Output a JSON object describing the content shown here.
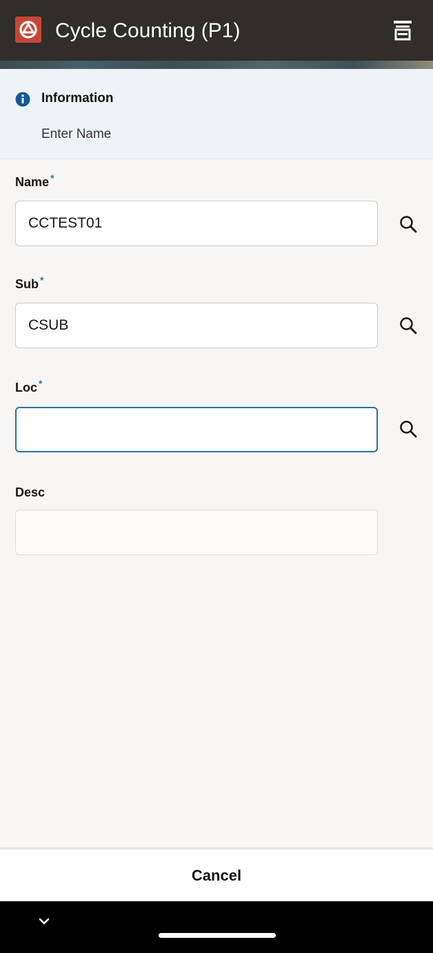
{
  "header": {
    "title": "Cycle Counting (P1)",
    "logo_icon": "oracle-logo-icon",
    "menu_icon": "page-menu-icon",
    "background_color": "#312d2a",
    "logo_color": "#c74634"
  },
  "info": {
    "icon": "info-icon",
    "title": "Information",
    "message": "Enter Name",
    "background_color": "#eef3f7"
  },
  "form": {
    "name": {
      "label": "Name",
      "required_marker": "*",
      "value": "CCTEST01",
      "search_icon": "search-icon"
    },
    "sub": {
      "label": "Sub",
      "required_marker": "*",
      "value": "CSUB",
      "search_icon": "search-icon"
    },
    "loc": {
      "label": "Loc",
      "required_marker": "*",
      "value": "",
      "search_icon": "search-icon"
    },
    "desc": {
      "label": "Desc",
      "value": ""
    },
    "required_color": "#227e9e",
    "focus_color": "#2f6f9e"
  },
  "footer": {
    "cancel_label": "Cancel"
  },
  "system_nav": {
    "back_icon": "chevron-down-icon",
    "home_indicator": "home-indicator"
  }
}
